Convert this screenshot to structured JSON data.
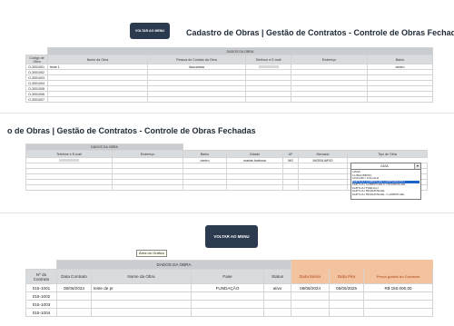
{
  "panel1": {
    "button": "VOLTAR AO MENU",
    "title": "Cadastro de Obras | Gestão de Contratos - Controle de Obras Fechad",
    "section_header": "DADOS DA OBRA",
    "columns": [
      "Código de Obra",
      "Nome da Obra",
      "Pessoa de Contato da Obra",
      "Telefone e E-mail",
      "Endereço",
      "Bairro"
    ],
    "rows": [
      [
        "O-3001001",
        "teste 1",
        "itaucariara",
        "",
        "",
        "centro"
      ],
      [
        "O-3001002",
        "",
        "",
        "",
        "",
        ""
      ],
      [
        "O-3001003",
        "",
        "",
        "",
        "",
        ""
      ],
      [
        "O-3001004",
        "",
        "",
        "",
        "",
        ""
      ],
      [
        "O-3001005",
        "",
        "",
        "",
        "",
        ""
      ],
      [
        "O-3001006",
        "",
        "",
        "",
        "",
        ""
      ],
      [
        "O-3001007",
        "",
        "",
        "",
        "",
        ""
      ]
    ]
  },
  "panel2": {
    "title": "o de Obras | Gestão de Contratos - Controle de Obras Fechadas",
    "section_header": "DADOS DA OBRA",
    "columns": [
      "Telefone e E-mail",
      "Endereço",
      "Bairro",
      "Cidade",
      "UF",
      "Mercado",
      "Tipo de Obra"
    ],
    "row": [
      "",
      "",
      "centro",
      "marias barbosa",
      "MG",
      "IMOBILIARIO",
      "CASA"
    ],
    "dropdown_options": [
      "CASA",
      "CONDOMINIO",
      "CRECHE / ESCOLA",
      "EDIFICIO COMERCIAL CORPORATIVO",
      "EDIFICIO COMERCIAL E RESIDENCIAL",
      "EDIFICIO PUBLICO",
      "EDIFICIO RESIDENCIAL",
      "EDIFICIO RESIDENCIAL / COMERCIAL"
    ],
    "dropdown_selected_index": 3
  },
  "panel3": {
    "button": "VOLTAR AO MENU",
    "tooltip": "Área do Gráfico",
    "section_header": "DADOS DA OBRA",
    "columns": [
      "Nº do Contrato",
      "Data Contrato",
      "Nome da Obra",
      "Fase",
      "Status",
      "Data Início",
      "Data Fim",
      "Preço global do Contrato"
    ],
    "rows": [
      [
        "015-1001",
        "08/08/2024",
        "teste de pr",
        "FUNDAÇÃO",
        "ativo",
        "08/08/2024",
        "05/05/2025",
        "R$ 150.000,00"
      ],
      [
        "015-1002",
        "",
        "",
        "",
        "",
        "",
        "",
        ""
      ],
      [
        "015-1003",
        "",
        "",
        "",
        "",
        "",
        "",
        ""
      ],
      [
        "015-1004",
        "",
        "",
        "",
        "",
        "",
        "",
        ""
      ]
    ]
  },
  "colors": {
    "button_bg": "#2b3a4e",
    "header_bg": "#c9ccd0",
    "peach_header": "#f3c29e",
    "dropdown_highlight": "#1e63c8"
  }
}
